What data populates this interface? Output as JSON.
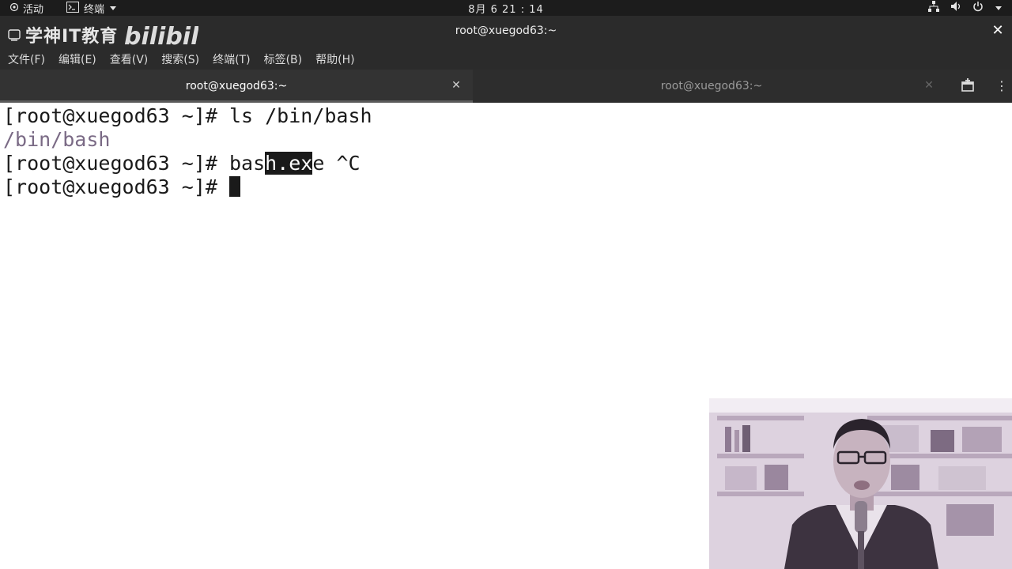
{
  "topbar": {
    "activities": "活动",
    "app_menu": "终端",
    "clock": "8月 6  21 : 14"
  },
  "window": {
    "title": "root@xuegod63:~"
  },
  "watermark": {
    "text": "学神IT教育",
    "logo": "bilibili"
  },
  "menubar": {
    "items": [
      "文件(F)",
      "编辑(E)",
      "查看(V)",
      "搜索(S)",
      "终端(T)",
      "标签(B)",
      "帮助(H)"
    ]
  },
  "tabs": [
    {
      "label": "root@xuegod63:~",
      "active": true
    },
    {
      "label": "root@xuegod63:~",
      "active": false
    }
  ],
  "terminal": {
    "line1": "[root@xuegod63 ~]# ls /bin/bash",
    "line2": "/bin/bash",
    "line3": {
      "prompt": "[root@xuegod63 ~]# ",
      "before_sel": "bas",
      "selected": "h.ex",
      "after_sel": "e ^C"
    },
    "line4": {
      "prompt": "[root@xuegod63 ~]# "
    }
  },
  "colors": {
    "topbar_bg": "#1c1c1c",
    "titlebar_bg": "#2b2b2b",
    "terminal_bg": "#ffffff",
    "terminal_fg": "#1a1a1a",
    "path_output": "#7a6a85"
  },
  "icons": {
    "topbar": [
      "terminal-icon",
      "chevron-down-icon",
      "network-icon",
      "volume-icon",
      "power-icon"
    ],
    "tabbar": [
      "new-tab-icon",
      "menu-icon"
    ]
  }
}
